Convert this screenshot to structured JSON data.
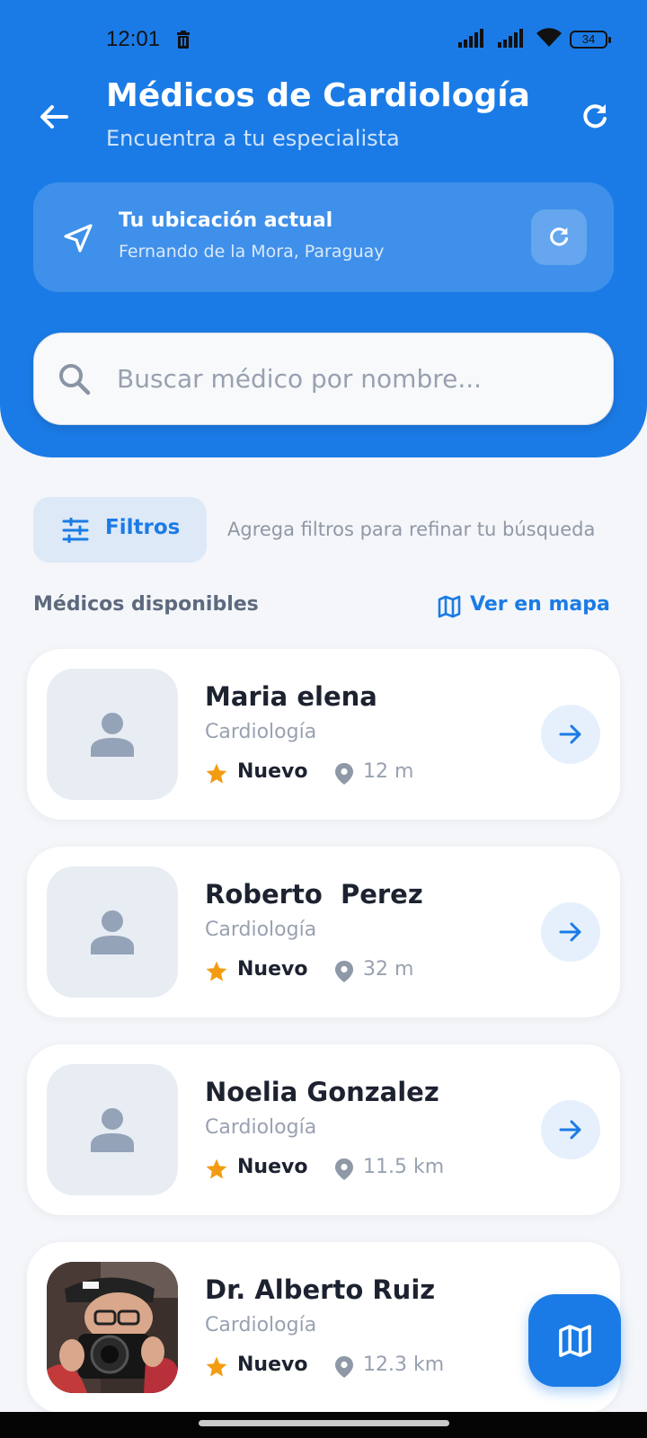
{
  "status_bar": {
    "time": "12:01",
    "battery": "34"
  },
  "header": {
    "title": "Médicos de Cardiología",
    "subtitle": "Encuentra a tu especialista"
  },
  "location": {
    "title": "Tu ubicación actual",
    "address": "Fernando de la Mora, Paraguay"
  },
  "search": {
    "placeholder": "Buscar médico por nombre..."
  },
  "filters": {
    "label": "Filtros",
    "hint": "Agrega filtros para refinar tu búsqueda"
  },
  "section": {
    "title": "Médicos disponibles",
    "map_link": "Ver en mapa"
  },
  "doctors": [
    {
      "name": "Maria elena",
      "specialty": "Cardiología",
      "rating": "Nuevo",
      "distance": "12 m",
      "photo": "placeholder-person"
    },
    {
      "name": "Roberto  Perez",
      "specialty": "Cardiología",
      "rating": "Nuevo",
      "distance": "32 m",
      "photo": "placeholder-person"
    },
    {
      "name": "Noelia Gonzalez",
      "specialty": "Cardiología",
      "rating": "Nuevo",
      "distance": "11.5 km",
      "photo": "placeholder-person"
    },
    {
      "name": "Dr. Alberto Ruiz",
      "specialty": "Cardiología",
      "rating": "Nuevo",
      "distance": "12.3 km",
      "photo": "photographer-with-camera"
    }
  ],
  "colors": {
    "primary": "#1b7be6",
    "background": "#f4f6f9",
    "star": "#f39c12"
  },
  "icons": [
    "back-arrow-icon",
    "refresh-icon",
    "navigation-arrow-icon",
    "search-icon",
    "sliders-icon",
    "map-icon",
    "person-icon",
    "star-icon",
    "location-pin-icon",
    "arrow-right-icon"
  ]
}
